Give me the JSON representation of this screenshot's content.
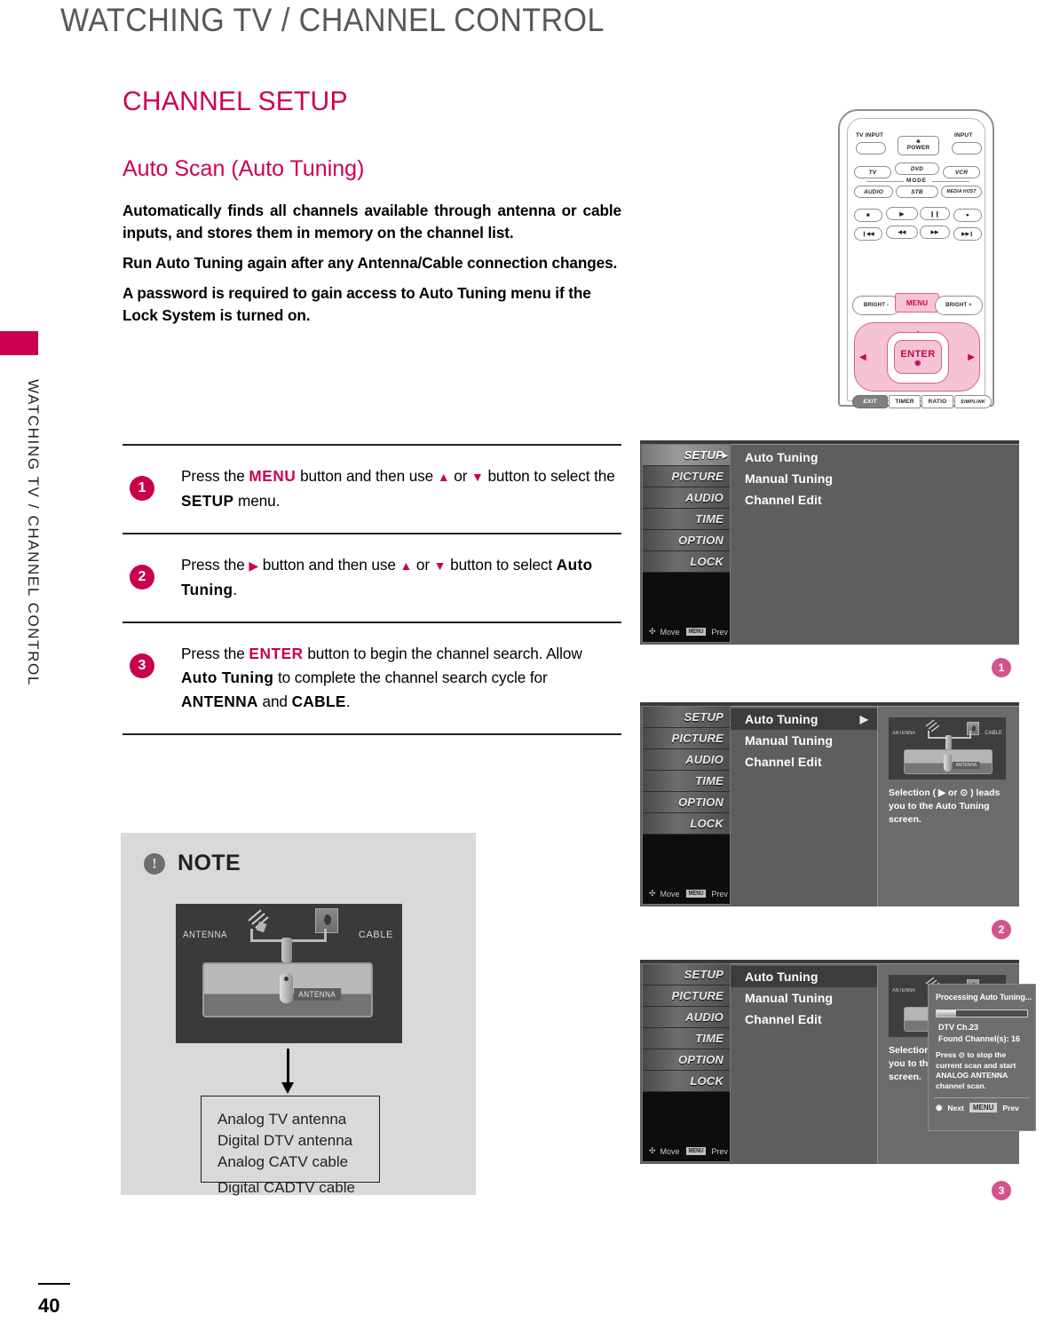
{
  "header": {
    "title": "WATCHING TV / CHANNEL CONTROL"
  },
  "sidebar": {
    "vertical_label": "WATCHING TV / CHANNEL CONTROL"
  },
  "content": {
    "h1": "CHANNEL SETUP",
    "h2": "Auto Scan (Auto Tuning)",
    "paragraphs": [
      "Automatically finds all channels available through antenna or cable inputs, and stores them in memory on the channel list.",
      "Run Auto Tuning again after any Antenna/Cable connection changes.",
      "A password is required to gain access to Auto Tuning menu if the Lock System is turned on."
    ]
  },
  "steps": [
    {
      "number": "1",
      "parts": [
        {
          "t": "Press the ",
          "s": "plain"
        },
        {
          "t": "MENU",
          "s": "pink"
        },
        {
          "t": " button and then use ",
          "s": "plain"
        },
        {
          "t": "▲",
          "s": "tri"
        },
        {
          "t": " or ",
          "s": "plain"
        },
        {
          "t": "▼",
          "s": "tri"
        },
        {
          "t": " button to select the ",
          "s": "plain"
        },
        {
          "t": "SETUP",
          "s": "bold"
        },
        {
          "t": " menu.",
          "s": "plain"
        }
      ]
    },
    {
      "number": "2",
      "parts": [
        {
          "t": "Press the ",
          "s": "plain"
        },
        {
          "t": "▶",
          "s": "tri"
        },
        {
          "t": " button and then use ",
          "s": "plain"
        },
        {
          "t": "▲",
          "s": "tri"
        },
        {
          "t": " or ",
          "s": "plain"
        },
        {
          "t": "▼",
          "s": "tri"
        },
        {
          "t": " button to select ",
          "s": "plain"
        },
        {
          "t": "Auto Tuning",
          "s": "bold"
        },
        {
          "t": ".",
          "s": "plain"
        }
      ]
    },
    {
      "number": "3",
      "parts": [
        {
          "t": "Press the ",
          "s": "plain"
        },
        {
          "t": "ENTER",
          "s": "pink"
        },
        {
          "t": " button to begin the channel search. Allow ",
          "s": "plain"
        },
        {
          "t": "Auto Tuning",
          "s": "bold"
        },
        {
          "t": " to complete the channel search cycle for ",
          "s": "plain"
        },
        {
          "t": "ANTENNA",
          "s": "bold"
        },
        {
          "t": " and ",
          "s": "plain"
        },
        {
          "t": "CABLE",
          "s": "bold"
        },
        {
          "t": ".",
          "s": "plain"
        }
      ]
    }
  ],
  "note": {
    "icon": "exclamation-icon",
    "title": "NOTE",
    "diagram": {
      "label_left": "ANTENNA",
      "label_right": "CABLE",
      "tv_port": "ANTENNA"
    },
    "list": [
      "Analog TV antenna",
      "Digital DTV antenna",
      "Analog CATV cable",
      "Digital CADTV cable"
    ]
  },
  "remote": {
    "tv_input": "TV INPUT",
    "power": "POWER",
    "input": "INPUT",
    "mode_label": "MODE",
    "mode_row1": [
      "TV",
      "DVD",
      "VCR"
    ],
    "mode_row2": [
      "AUDIO",
      "STB",
      "MEDIA HOST"
    ],
    "transport_row1": [
      "■",
      "▶",
      "❙❙",
      "●"
    ],
    "transport_row2": [
      "❙◀◀",
      "◀◀",
      "▶▶",
      "▶▶❙"
    ],
    "bright_minus": "BRIGHT -",
    "menu": "MENU",
    "bright_plus": "BRIGHT +",
    "enter": "ENTER",
    "bottom_row": [
      "EXIT",
      "TIMER",
      "RATIO",
      "SIMPLINK"
    ]
  },
  "osd": {
    "side_items": [
      "SETUP",
      "PICTURE",
      "AUDIO",
      "TIME",
      "OPTION",
      "LOCK"
    ],
    "footer_move": "Move",
    "footer_menu_chip": "MENU",
    "footer_prev": "Prev",
    "menu_items": [
      "Auto Tuning",
      "Manual Tuning",
      "Channel Edit"
    ],
    "right_panel_text": "Selection ( ▶ or ⊙ ) leads you to the Auto Tuning screen.",
    "diagram": {
      "label_left": "ANTENNA",
      "label_right": "CABLE",
      "tv_port": "ANTENNA"
    }
  },
  "dialog": {
    "title": "Processing Auto Tuning...",
    "progress_percent": 22,
    "channel_line": "DTV Ch.23",
    "found_line": "Found Channel(s): 16",
    "instruction": "Press ⊙ to stop the current scan and start ANALOG ANTENNA channel  scan.",
    "footer_next": "Next",
    "footer_menu_chip": "MENU",
    "footer_prev": "Prev"
  },
  "callouts": {
    "one": "1",
    "two": "2",
    "three": "3"
  },
  "footer": {
    "page_number": "40"
  },
  "colors": {
    "brand_pink": "#cc0051",
    "tab_pink": "#c8004e",
    "note_bg": "#d9d9d9",
    "header_gray": "#58585a",
    "osd_gray": "#5e5e5e"
  }
}
